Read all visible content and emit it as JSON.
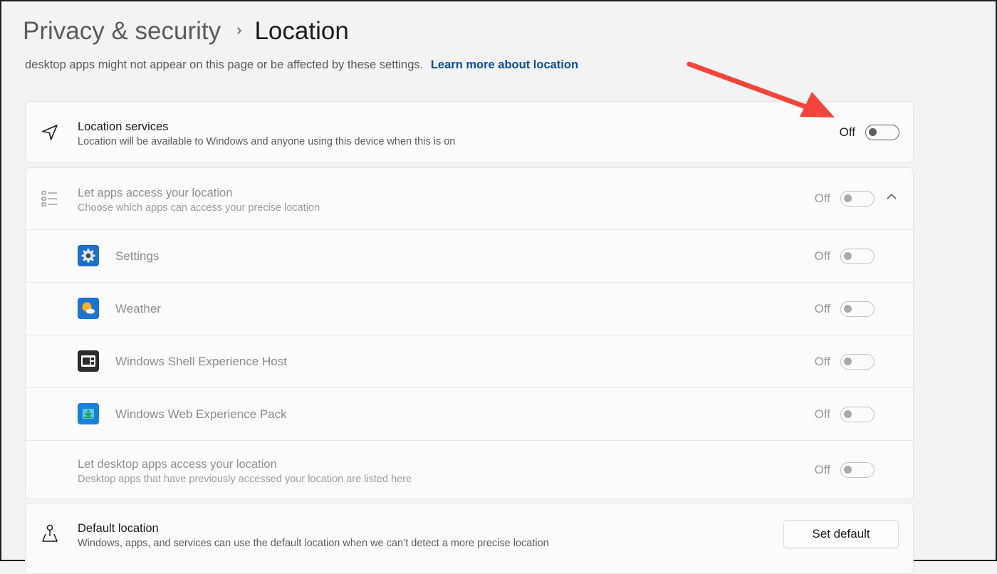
{
  "breadcrumb": {
    "parent": "Privacy & security",
    "separator": "›",
    "current": "Location"
  },
  "intro": {
    "text": "desktop apps might not appear on this page or be affected by these settings.",
    "link": "Learn more about location"
  },
  "location_services": {
    "title": "Location services",
    "description": "Location will be available to Windows and anyone using this device when this is on",
    "state": "Off",
    "icon": "navigation-arrow-icon"
  },
  "app_access": {
    "title": "Let apps access your location",
    "description": "Choose which apps can access your precise location",
    "state": "Off",
    "icon": "list-icon",
    "apps": [
      {
        "name": "Settings",
        "state": "Off",
        "icon": "settings-gear-icon"
      },
      {
        "name": "Weather",
        "state": "Off",
        "icon": "weather-sun-icon"
      },
      {
        "name": "Windows Shell Experience Host",
        "state": "Off",
        "icon": "shell-window-icon"
      },
      {
        "name": "Windows Web Experience Pack",
        "state": "Off",
        "icon": "web-experience-download-icon"
      }
    ],
    "desktop": {
      "title": "Let desktop apps access your location",
      "description": "Desktop apps that have previously accessed your location are listed here",
      "state": "Off"
    }
  },
  "default_location": {
    "title": "Default location",
    "description": "Windows, apps, and services can use the default location when we can’t detect a more precise location",
    "button": "Set default",
    "icon": "map-pin-icon"
  },
  "colors": {
    "accent_link": "#0b4ea2",
    "annotation_arrow": "#f2463d"
  }
}
